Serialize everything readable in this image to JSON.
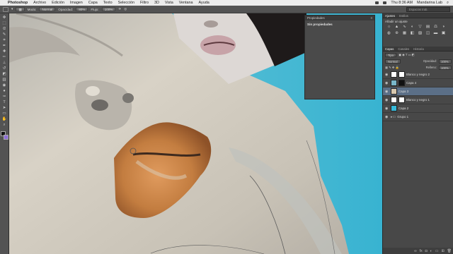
{
  "menu": {
    "apple": "",
    "app_name": "Photoshop",
    "items": [
      "Archivo",
      "Edición",
      "Imagen",
      "Capa",
      "Texto",
      "Selección",
      "Filtro",
      "3D",
      "Vista",
      "Ventana",
      "Ayuda"
    ],
    "clock": "Thu 8:36 AM",
    "user": "Mandarina Lab"
  },
  "options": {
    "mode_label": "Modo:",
    "mode_value": "Normal",
    "opacity_label": "Opacidad:",
    "opacity_value": "80%",
    "flow_label": "Flujo:",
    "flow_value": "100%",
    "search_placeholder": "Espacios trab."
  },
  "properties": {
    "title": "Propiedades",
    "subtitle": "Sin propiedades"
  },
  "dock": {
    "tabs": [
      "Ajustes",
      "Estilos"
    ],
    "adjust_title": "Añadir un ajuste",
    "layer_tabs": [
      "Capas",
      "Canales",
      "Historia"
    ],
    "kind_select": "Tipo",
    "blend_mode": "Normal",
    "opacity_label": "Opacidad:",
    "opacity_value": "100%",
    "fill_label": "Relleno:",
    "fill_value": "100%",
    "layers": [
      {
        "name": "Blanco y negro 2",
        "thumb_color": "#ffffff",
        "has_mask": true,
        "selected": false,
        "folder": false
      },
      {
        "name": "Capa 4",
        "thumb_color": "#7ab7c9",
        "has_mask": true,
        "selected": false,
        "folder": false
      },
      {
        "name": "Capa 3",
        "thumb_color": "#d8c9b0",
        "has_mask": false,
        "selected": true,
        "folder": false
      },
      {
        "name": "Blanco y negro 1",
        "thumb_color": "#ffffff",
        "has_mask": true,
        "selected": false,
        "folder": false
      },
      {
        "name": "Capa 2",
        "thumb_color": "#36b9d9",
        "has_mask": false,
        "selected": false,
        "folder": false
      },
      {
        "name": "Grupo 1",
        "thumb_color": "#474747",
        "has_mask": false,
        "selected": false,
        "folder": true
      }
    ]
  },
  "colors": {
    "foreground": "#111111",
    "background": "#8d6ed8",
    "lip": "#c9864a",
    "skin": "#cdc7bb",
    "backdrop_blue": "#4fbfd6"
  }
}
